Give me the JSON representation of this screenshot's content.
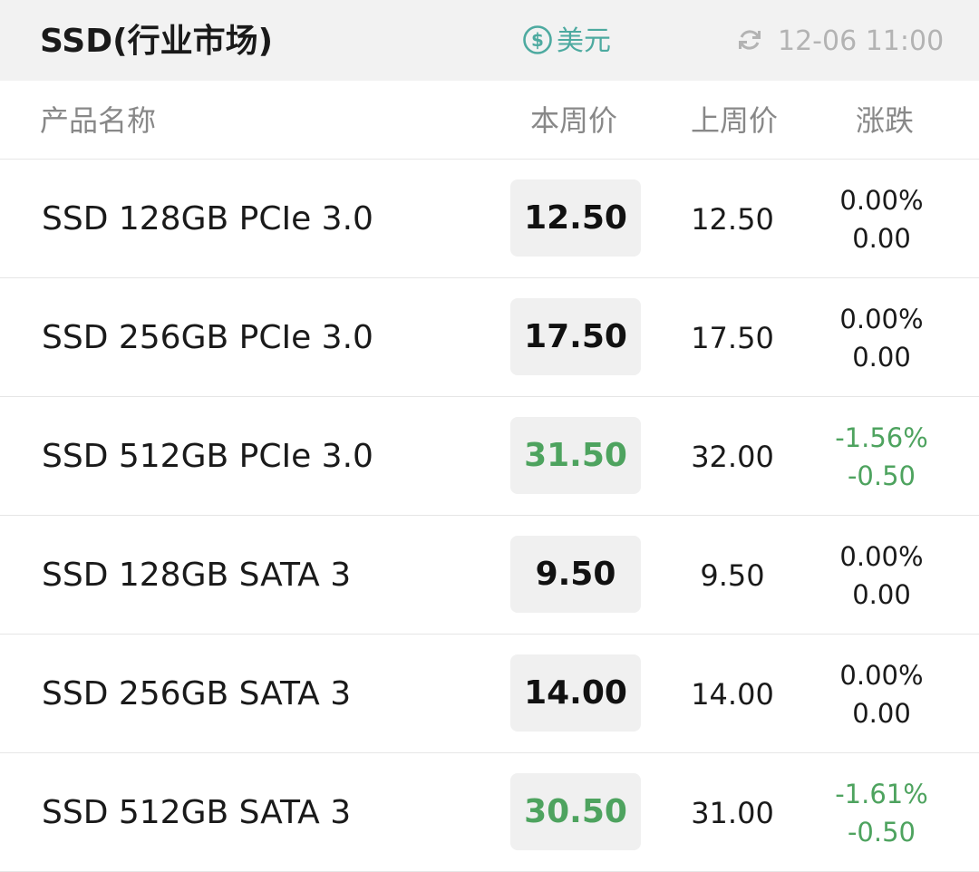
{
  "header": {
    "title": "SSD(行业市场)",
    "currency_label": "美元",
    "currency_icon": "dollar-circle-icon",
    "refresh_icon": "refresh-icon",
    "timestamp": "12-06 11:00"
  },
  "columns": {
    "name": "产品名称",
    "this_week": "本周价",
    "last_week": "上周价",
    "change": "涨跌"
  },
  "colors": {
    "accent": "#4daaa0",
    "down": "#4ea35f",
    "flat": "#1a1a1a"
  },
  "rows": [
    {
      "name": "SSD 128GB PCIe 3.0",
      "price": "12.50",
      "last": "12.50",
      "pct": "0.00%",
      "diff": "0.00",
      "trend": "flat"
    },
    {
      "name": "SSD 256GB PCIe 3.0",
      "price": "17.50",
      "last": "17.50",
      "pct": "0.00%",
      "diff": "0.00",
      "trend": "flat"
    },
    {
      "name": "SSD 512GB PCIe 3.0",
      "price": "31.50",
      "last": "32.00",
      "pct": "-1.56%",
      "diff": "-0.50",
      "trend": "down"
    },
    {
      "name": "SSD 128GB SATA 3",
      "price": "9.50",
      "last": "9.50",
      "pct": "0.00%",
      "diff": "0.00",
      "trend": "flat"
    },
    {
      "name": "SSD 256GB SATA 3",
      "price": "14.00",
      "last": "14.00",
      "pct": "0.00%",
      "diff": "0.00",
      "trend": "flat"
    },
    {
      "name": "SSD 512GB SATA 3",
      "price": "30.50",
      "last": "31.00",
      "pct": "-1.61%",
      "diff": "-0.50",
      "trend": "down"
    }
  ]
}
